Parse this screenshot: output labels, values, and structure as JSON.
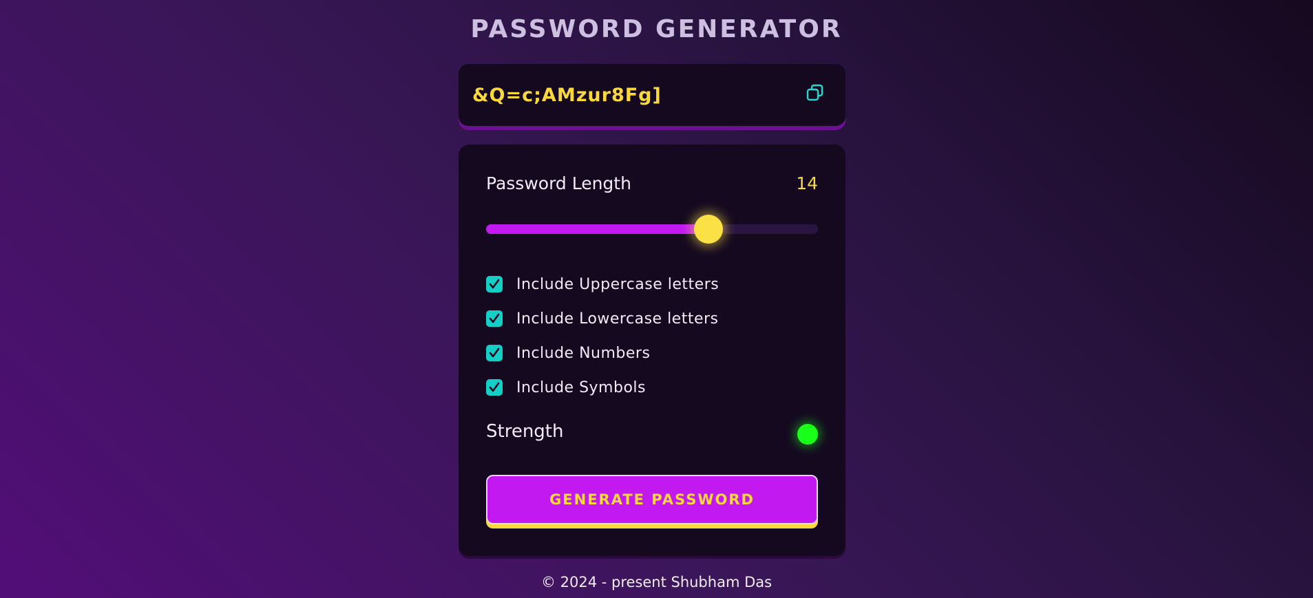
{
  "header": {
    "title": "PASSWORD GENERATOR"
  },
  "display": {
    "password": "&Q=c;AMzur8Fg]",
    "copy_icon": "copy-icon"
  },
  "length": {
    "label": "Password Length",
    "value": "14",
    "slider_fraction": 0.67
  },
  "options": [
    {
      "label": "Include Uppercase letters",
      "checked": true
    },
    {
      "label": "Include Lowercase letters",
      "checked": true
    },
    {
      "label": "Include Numbers",
      "checked": true
    },
    {
      "label": "Include Symbols",
      "checked": true
    }
  ],
  "strength": {
    "label": "Strength",
    "indicator_color": "#1aff1a"
  },
  "actions": {
    "generate_label": "GENERATE PASSWORD"
  },
  "footer": {
    "text": "© 2024 - present Shubham Das"
  },
  "colors": {
    "accent_yellow": "#fbd93a",
    "accent_purple": "#c219f0",
    "checkbox_teal": "#14cfc6",
    "card_background": "#150920"
  }
}
